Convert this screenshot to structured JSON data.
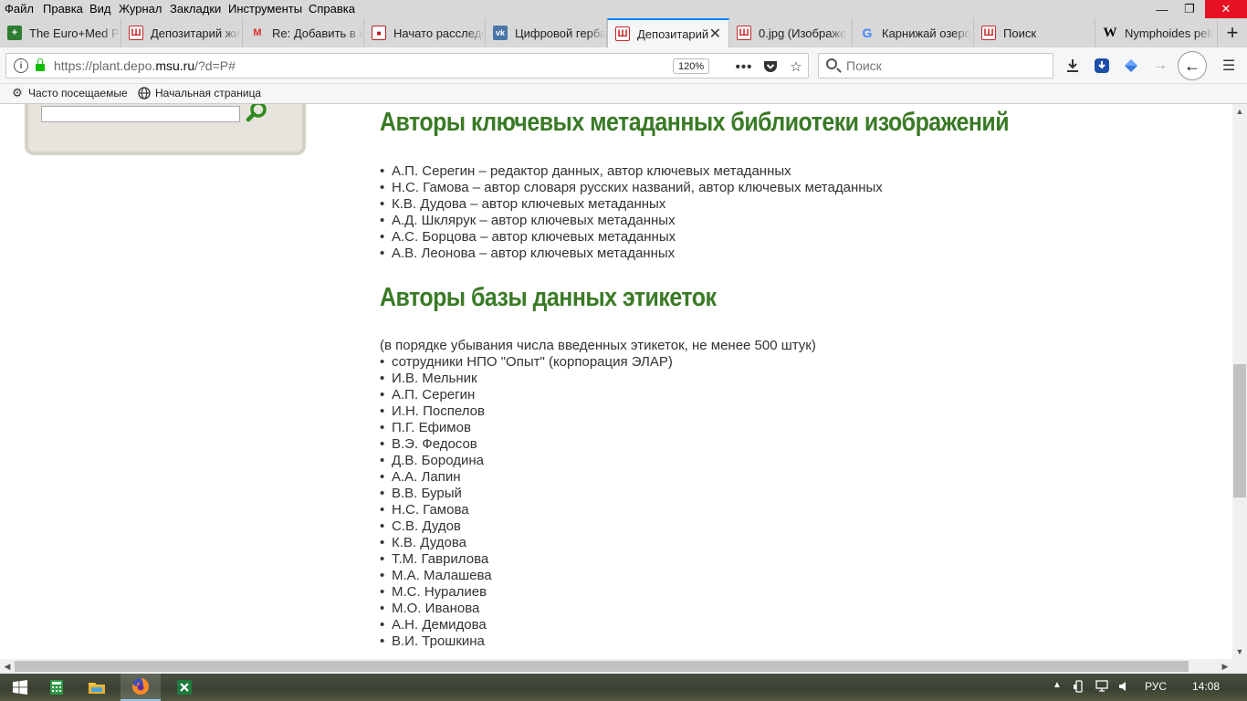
{
  "menu": [
    "Файл",
    "Правка",
    "Вид",
    "Журнал",
    "Закладки",
    "Инструменты",
    "Справка"
  ],
  "window_controls": {
    "minimize": "—",
    "restore": "❐",
    "close": "✕"
  },
  "tabs": [
    {
      "title": "The Euro+Med P",
      "icon": "euromed-icon",
      "icon_text": "+"
    },
    {
      "title": "Депозитарий жи",
      "icon": "depo-icon",
      "icon_text": "Ш"
    },
    {
      "title": "Re: Добавить в к",
      "icon": "gmail-icon",
      "icon_text": "M"
    },
    {
      "title": "Начато расследо",
      "icon": "doc-icon",
      "icon_text": "■"
    },
    {
      "title": "Цифровой герба",
      "icon": "vk-icon",
      "icon_text": "vk"
    },
    {
      "title": "Депозитарий",
      "icon": "depo-icon",
      "icon_text": "Ш",
      "active": true
    },
    {
      "title": "0.jpg (Изображе",
      "icon": "depo-icon",
      "icon_text": "Ш"
    },
    {
      "title": "Карнижай озеро",
      "icon": "google-icon",
      "icon_text": "G"
    },
    {
      "title": "Поиск",
      "icon": "depo-icon",
      "icon_text": "Ш"
    },
    {
      "title": "Nymphoides pelt",
      "icon": "wikipedia-icon",
      "icon_text": "W"
    }
  ],
  "address": {
    "prefix": "https://plant.depo.",
    "domain": "msu.ru",
    "suffix": "/?d=P#",
    "zoom": "120%"
  },
  "search": {
    "placeholder": "Поиск"
  },
  "bookmarks": [
    {
      "label": "Часто посещаемые",
      "icon": "gear-icon"
    },
    {
      "label": "Начальная страница",
      "icon": "globe-icon"
    }
  ],
  "sections": {
    "metadata_heading": "Авторы ключевых метаданных библиотеки изображений",
    "metadata_authors": [
      "А.П. Серегин – редактор данных, автор ключевых метаданных",
      "Н.С. Гамова – автор словаря русских названий, автор ключевых метаданных",
      "К.В. Дудова – автор ключевых метаданных",
      "А.Д. Шклярук – автор ключевых метаданных",
      "А.С. Борцова – автор ключевых метаданных",
      "А.В. Леонова – автор ключевых метаданных"
    ],
    "labels_heading": "Авторы базы данных этикеток",
    "labels_note": "(в порядке убывания числа введенных этикеток, не менее 500 штук)",
    "labels_authors": [
      "сотрудники НПО \"Опыт\" (корпорация ЭЛАР)",
      "И.В. Мельник",
      "А.П. Серегин",
      "И.Н. Поспелов",
      "П.Г. Ефимов",
      "В.Э. Федосов",
      "Д.В. Бородина",
      "А.А. Лапин",
      "В.В. Бурый",
      "Н.С. Гамова",
      "С.В. Дудов",
      "К.В. Дудова",
      "Т.М. Гаврилова",
      "М.А. Малашева",
      "М.С. Нуралиев",
      "М.О. Иванова",
      "А.Н. Демидова",
      "В.И. Трошкина"
    ]
  },
  "tray": {
    "lang": "РУС",
    "time": "14:08"
  },
  "colors": {
    "heading": "#3a7a26",
    "accent_tab": "#0a84ff",
    "close_red": "#e81123"
  }
}
